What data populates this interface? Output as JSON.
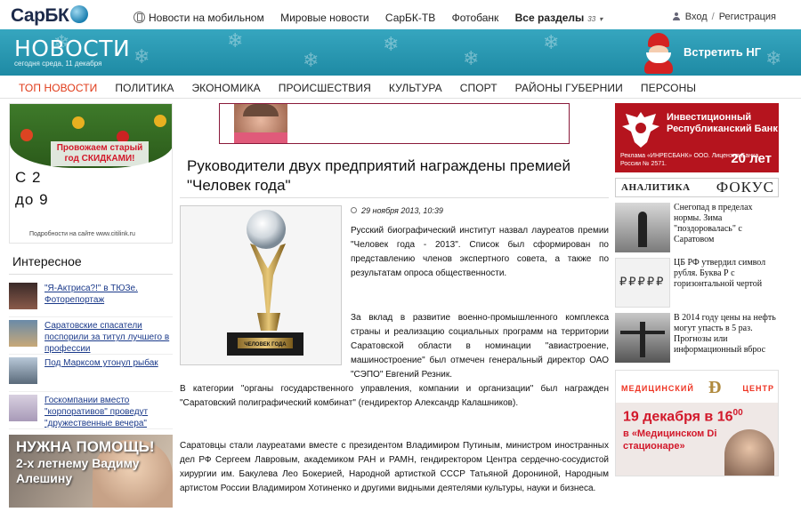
{
  "logo": "СарБК",
  "topnav": {
    "mobile": "Новости на мобильном",
    "world": "Мировые новости",
    "tv": "СарБК-ТВ",
    "photo": "Фотобанк",
    "all": "Все разделы",
    "all_count": "33"
  },
  "auth": {
    "login": "Вход",
    "register": "Регистрация"
  },
  "banner": {
    "title": "НОВОСТИ",
    "date": "сегодня среда, 11 декабря",
    "ng": "Встретить НГ"
  },
  "mainnav": [
    "ТОП НОВОСТИ",
    "ПОЛИТИКА",
    "ЭКОНОМИКА",
    "ПРОИСШЕСТВИЯ",
    "КУЛЬТУРА",
    "СПОРТ",
    "РАЙОНЫ ГУБЕРНИИ",
    "ПЕРСОНЫ"
  ],
  "left": {
    "ad_text": "Провожаем старый год СКИДКАМИ!",
    "ad_big1": "С 2",
    "ad_big2": "до 9",
    "ad_site": "Подробности на сайте www.citilink.ru",
    "interesting_title": "Интересное",
    "interesting": [
      "\"Я-Актриса?!\" в ТЮЗе. Фоторепортаж",
      "Саратовские спасатели поспорили за титул лучшего в профессии",
      "Под Марксом утонул рыбак",
      "Госкомпании вместо \"корпоративов\" проведут \"дружественные вечера\""
    ],
    "help_title": "НУЖНА ПОМОЩЬ!",
    "help_sub": "2-х летнему Вадиму Алешину"
  },
  "article": {
    "title": "Руководители двух предприятий награждены премией \"Человек года\"",
    "date": "29 ноября 2013, 10:39",
    "trophy_label": "ЧЕЛОВЕК ГОДА",
    "p1": "Русский биографический институт назвал лауреатов премии \"Человек года - 2013\". Список был сформирован по представлению членов экспертного совета, а также по результатам опроса общественности.",
    "p2": "За вклад в развитие военно-промышленного комплекса страны и реализацию социальных программ на территории Саратовской области в номинации \"авиастроение, машиностроение\" был отмечен генеральный директор ОАО \"СЭПО\" Евгений Резник.",
    "p3": "В категории \"органы государственного управления, компании и организации\" был награжден \"Саратовский полиграфический комбинат\" (гендиректор Александр Калашников).",
    "p4": "Саратовцы стали лауреатами вместе с президентом Владимиром Путиным, министром иностранных дел РФ Сергеем Лавровым, академиком РАН и РАМН, гендиректором Центра сердечно-сосудистой хирургии им. Бакулева Лео Бокерией, Народной артисткой СССР Татьяной Дорониной, Народным артистом России Владимиром Хотиненко и другими видными деятелями культуры, науки и бизнеса."
  },
  "right": {
    "bank_name": "Инвестиционный Республиканский Банк",
    "bank_small": "Реклама «ИНРЕСБАНК» ООО. Лицензия Банка России № 2571.",
    "bank_years": "20 лет",
    "analytics": "АНАЛИТИКА",
    "fokus": "ФОКУС",
    "items": [
      "Снегопад в пределах нормы. Зима \"поздоровалась\" с Саратовом",
      "ЦБ РФ утвердил символ рубля. Буква Р с горизонтальной чертой",
      "В 2014 году цены на нефть могут упасть в 5 раз. Прогнозы или информационный вброс"
    ],
    "med_left": "МЕДИЦИНСКИЙ",
    "med_right": "ЦЕНТР",
    "med_date": "19 декабря в 16",
    "med_date_sup": "00",
    "med_sub": "в «Медицинском Di стационаре»"
  }
}
